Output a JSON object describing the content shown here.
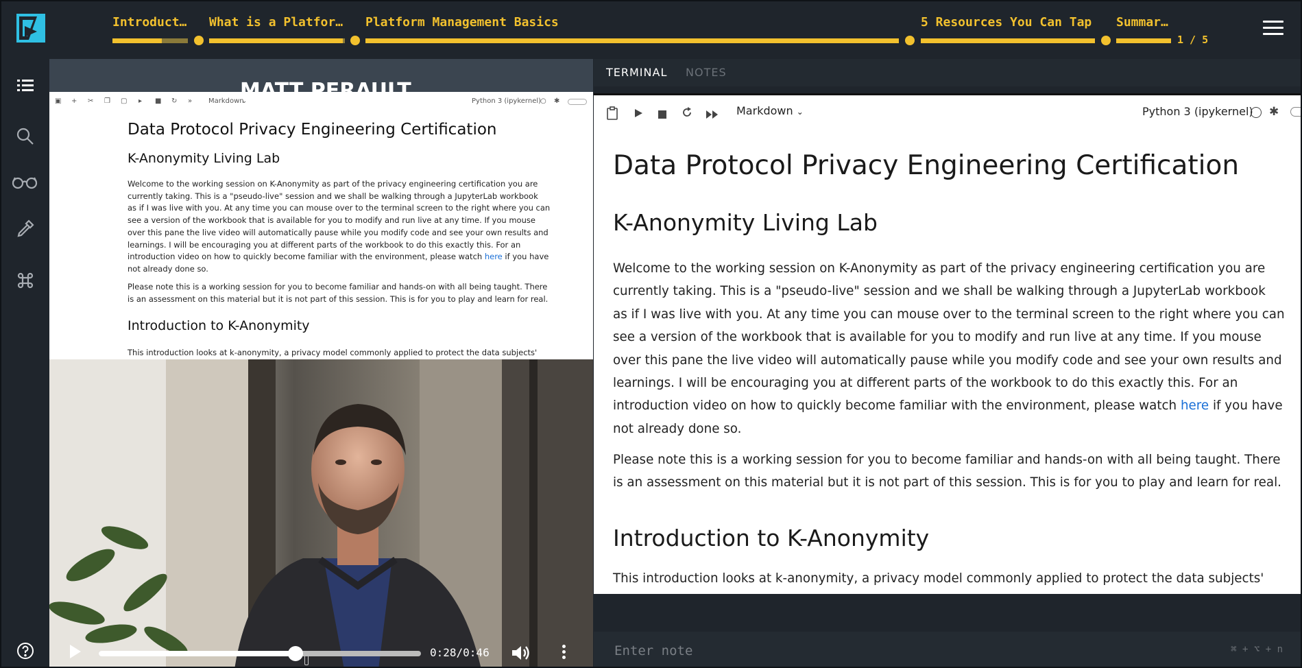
{
  "chapters": [
    {
      "label": "Introduct…"
    },
    {
      "label": "What is a Platfor…"
    },
    {
      "label": "Platform Management Basics"
    },
    {
      "label": "5 Resources You Can Tap"
    },
    {
      "label": "Summar…"
    }
  ],
  "chapter_counter": "1 / 5",
  "first_chapter_progress": 0.65,
  "sidebar": {
    "icons": [
      "list-icon",
      "search-icon",
      "glasses-icon",
      "dropper-icon",
      "command-icon",
      "help-icon"
    ]
  },
  "video": {
    "slide_title": "MATT PERAULT",
    "time": "0:28/0:46",
    "progress": 0.61
  },
  "small_notebook": {
    "kernel": "Python 3 (ipykernel)",
    "cell_type": "Markdown",
    "h1": "Data Protocol Privacy Engineering Certification",
    "h2": "K-Anonymity Living Lab",
    "p1_lines": [
      "Welcome to the working session on K-Anonymity as part of the privacy engineering certification you are",
      "currently taking. This is a \"pseudo-live\" session and we shall be walking through a JupyterLab workbook",
      "as if I was live with you. At any time you can mouse over to the terminal screen to the right where you can",
      "see a version of the workbook that is available for you to modify and run live at any time. If you mouse",
      "over this pane the live video will automatically pause while you modify code and see your own results and",
      "learnings. I will be encouraging you at different parts of the workbook to do this exactly this. For an"
    ],
    "p1_last_before": "introduction video on how to quickly become familiar with the environment, please watch ",
    "p1_link": "here",
    "p1_last_after": " if you have",
    "p1_end": "not already done so.",
    "p2_lines": [
      "Please note this is a working session for you to become familiar and hands-on with all being taught. There",
      "is an assessment on this material but it is not part of this session. This is for you to play and learn for real."
    ],
    "h3": "Introduction to K-Anonymity",
    "p3": "This introduction looks at k-anonymity, a privacy model commonly applied to protect the data subjects'"
  },
  "right_panel": {
    "tabs": {
      "terminal": "TERMINAL",
      "notes": "NOTES"
    },
    "kernel": "Python 3 (ipykernel)",
    "cell_type": "Markdown",
    "h1": "Data Protocol Privacy Engineering Certification",
    "h2": "K-Anonymity Living Lab",
    "p1_lines": [
      "Welcome to the working session on K-Anonymity as part of the privacy engineering certification you are",
      "currently taking. This is a \"pseudo-live\" session and we shall be walking through a JupyterLab workbook",
      "as if I was live with you. At any time you can mouse over to the terminal screen to the right where you can",
      "see a version of the workbook that is available for you to modify and run live at any time. If you mouse",
      "over this pane the live video will automatically pause while you modify code and see your own results and",
      "learnings. I will be encouraging you at different parts of the workbook to do this exactly this. For an"
    ],
    "p1_last_before": "introduction video on how to quickly become familiar with the environment, please watch ",
    "p1_link": "here",
    "p1_last_after": " if you have",
    "p1_end": "not already done so.",
    "p2_lines": [
      "Please note this is a working session for you to become familiar and hands-on with all being taught. There",
      "is an assessment on this material but it is not part of this session. This is for you to play and learn for real."
    ],
    "h3": "Introduction to K-Anonymity",
    "p3": "This introduction looks at k-anonymity, a privacy model commonly applied to protect the data subjects'",
    "note_placeholder": "Enter note",
    "note_shortcut": "⌘ + ⌥ + n"
  },
  "colors": {
    "accent": "#f2c12e",
    "logo": "#2fc0e4",
    "link": "#1a6fd6"
  }
}
